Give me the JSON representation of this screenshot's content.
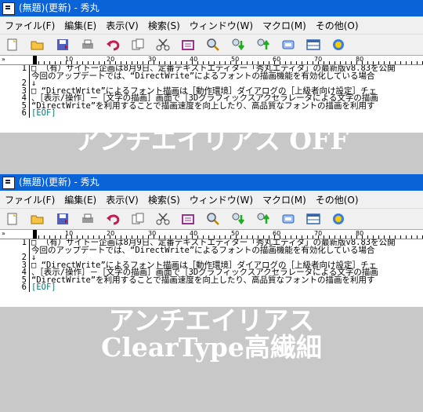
{
  "window": {
    "title": "(無題)(更新) - 秀丸"
  },
  "menu": [
    "ファイル(F)",
    "編集(E)",
    "表示(V)",
    "検索(S)",
    "ウィンドウ(W)",
    "マクロ(M)",
    "その他(O)"
  ],
  "toolbar": [
    "new-file-icon",
    "open-folder-icon",
    "save-icon",
    "print-icon",
    "undo-icon",
    "copy-icon",
    "cut-icon",
    "paste-icon",
    "search-icon",
    "search-down-icon",
    "search-up-icon",
    "replace-icon",
    "window-icon",
    "help-icon"
  ],
  "ruler": {
    "marks": [
      "10",
      "20",
      "30",
      "40",
      "50",
      "60",
      "70",
      "80"
    ],
    "prefix": "»"
  },
  "lines": [
    {
      "num": "1",
      "text": "□ （有）サイトー企画は8月9日、定番テキストエディター「秀丸エディタ」の最新版v8.83を公開"
    },
    {
      "num": "",
      "text": "今回のアップデートでは、“DirectWrite”によるフォントの描画機能を有効化している場合"
    },
    {
      "num": "2",
      "text": "↓"
    },
    {
      "num": "3",
      "text": "□ “DirectWrite”によるフォント描画は［動作環境］ダイアログの［上級者向け設定］チェ"
    },
    {
      "num": "4",
      "text": "、［表示/操作］－［文字の描画］画面で［3Dグラフィックスアクセラレータによる文字の描画"
    },
    {
      "num": "5",
      "text": "“DirectWrite”を利用することで描画速度を向上したり、高品質なフォントの描画を利用す"
    },
    {
      "num": "6",
      "text": "[EOF]"
    }
  ],
  "panels": [
    {
      "caption_line1": "アンチエイリアス OFF",
      "caption_line2": ""
    },
    {
      "caption_line1": "アンチエイリアス",
      "caption_line2": "ClearType高繊細"
    }
  ]
}
